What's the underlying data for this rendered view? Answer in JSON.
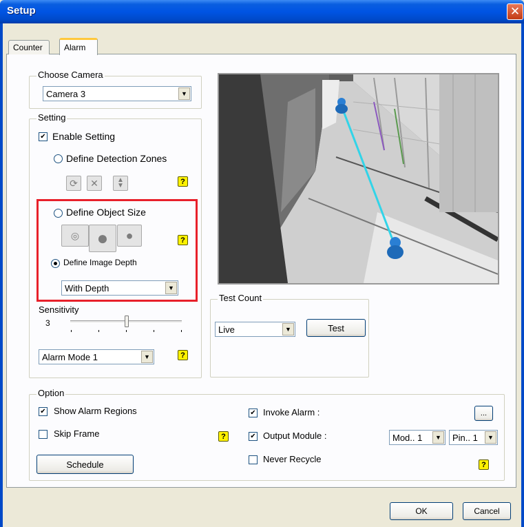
{
  "window": {
    "title": "Setup",
    "close_glyph": "✕"
  },
  "tabs": [
    {
      "label": "Counter",
      "active": false
    },
    {
      "label": "Alarm",
      "active": true
    }
  ],
  "choose_camera": {
    "legend": "Choose Camera",
    "value": "Camera 3"
  },
  "setting": {
    "legend": "Setting",
    "enable_label": "Enable Setting",
    "enable_checked": true,
    "zones_label": "Define Detection Zones",
    "object_size_label": "Define Object Size",
    "image_depth_label": "Define Image Depth",
    "image_depth_selected": true,
    "depth_combo": "With Depth",
    "sensitivity_label": "Sensitivity",
    "sensitivity_value": "3",
    "alarm_mode": "Alarm Mode 1"
  },
  "test_count": {
    "legend": "Test Count",
    "mode": "Live",
    "test_button": "Test"
  },
  "option": {
    "legend": "Option",
    "show_alarm_regions": "Show Alarm Regions",
    "show_alarm_regions_checked": true,
    "skip_frame": "Skip Frame",
    "skip_frame_checked": false,
    "schedule_button": "Schedule",
    "invoke_alarm": "Invoke Alarm :",
    "invoke_alarm_checked": true,
    "output_module": "Output Module :",
    "output_module_checked": true,
    "never_recycle": "Never Recycle",
    "never_recycle_checked": false,
    "browse_button": "...",
    "module_combo": "Mod.. 1",
    "pin_combo": "Pin.. 1"
  },
  "help_glyph": "?",
  "footer": {
    "ok": "OK",
    "cancel": "Cancel"
  },
  "colors": {
    "highlight_box": "#E8202A",
    "titlebar": "#0054E3",
    "help_icon": "#FFF200",
    "track_line": "#32D4E8",
    "person_marker": "#2A7FD4"
  }
}
